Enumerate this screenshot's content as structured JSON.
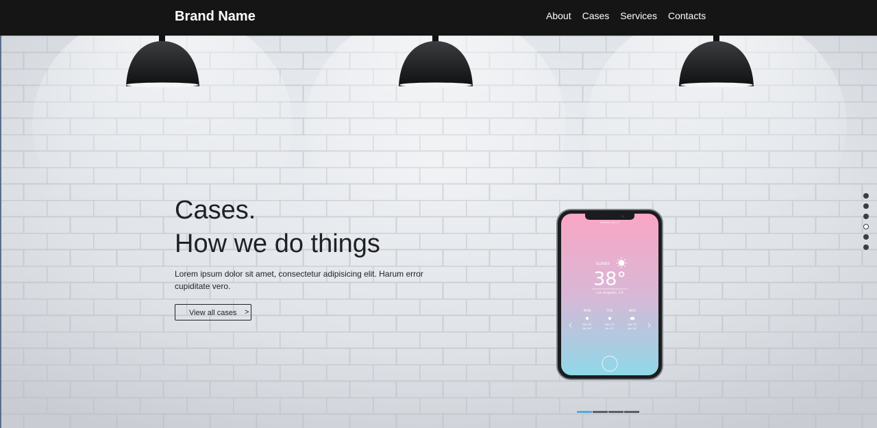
{
  "navbar": {
    "brand": "Brand Name",
    "links": [
      "About",
      "Cases",
      "Services",
      "Contacts"
    ]
  },
  "hero": {
    "title_line1": "Cases.",
    "title_line2": "How we do things",
    "description": "Lorem ipsum dolor sit amet, consectetur adipisicing elit. Harum error cupiditate vero.",
    "button_label": "View all cases",
    "button_arrow": ">"
  },
  "phone_screen": {
    "status_time": "Monday, Sep 12",
    "condition": "SUNNY",
    "temperature": "38°",
    "location": "Los Angeles, CA",
    "days": [
      "MON",
      "TUE",
      "WED"
    ],
    "highs": [
      "Max 78°",
      "Max 75°",
      "Max 72°"
    ],
    "lows": [
      "Min 59°",
      "Min 57°",
      "Min 54°"
    ]
  },
  "side_nav": {
    "count": 6,
    "active_index": 3
  },
  "slider": {
    "count": 4,
    "active_index": 0
  },
  "colors": {
    "navbar_bg": "#151515",
    "text_dark": "#202124",
    "indicator_active": "#5aa7d6",
    "phone_gradient_top": "#f9a6c4",
    "phone_gradient_bottom": "#8fd8e8"
  },
  "icons": {
    "weather": "sun-icon",
    "lamp": "pendant-lamp-icon"
  }
}
